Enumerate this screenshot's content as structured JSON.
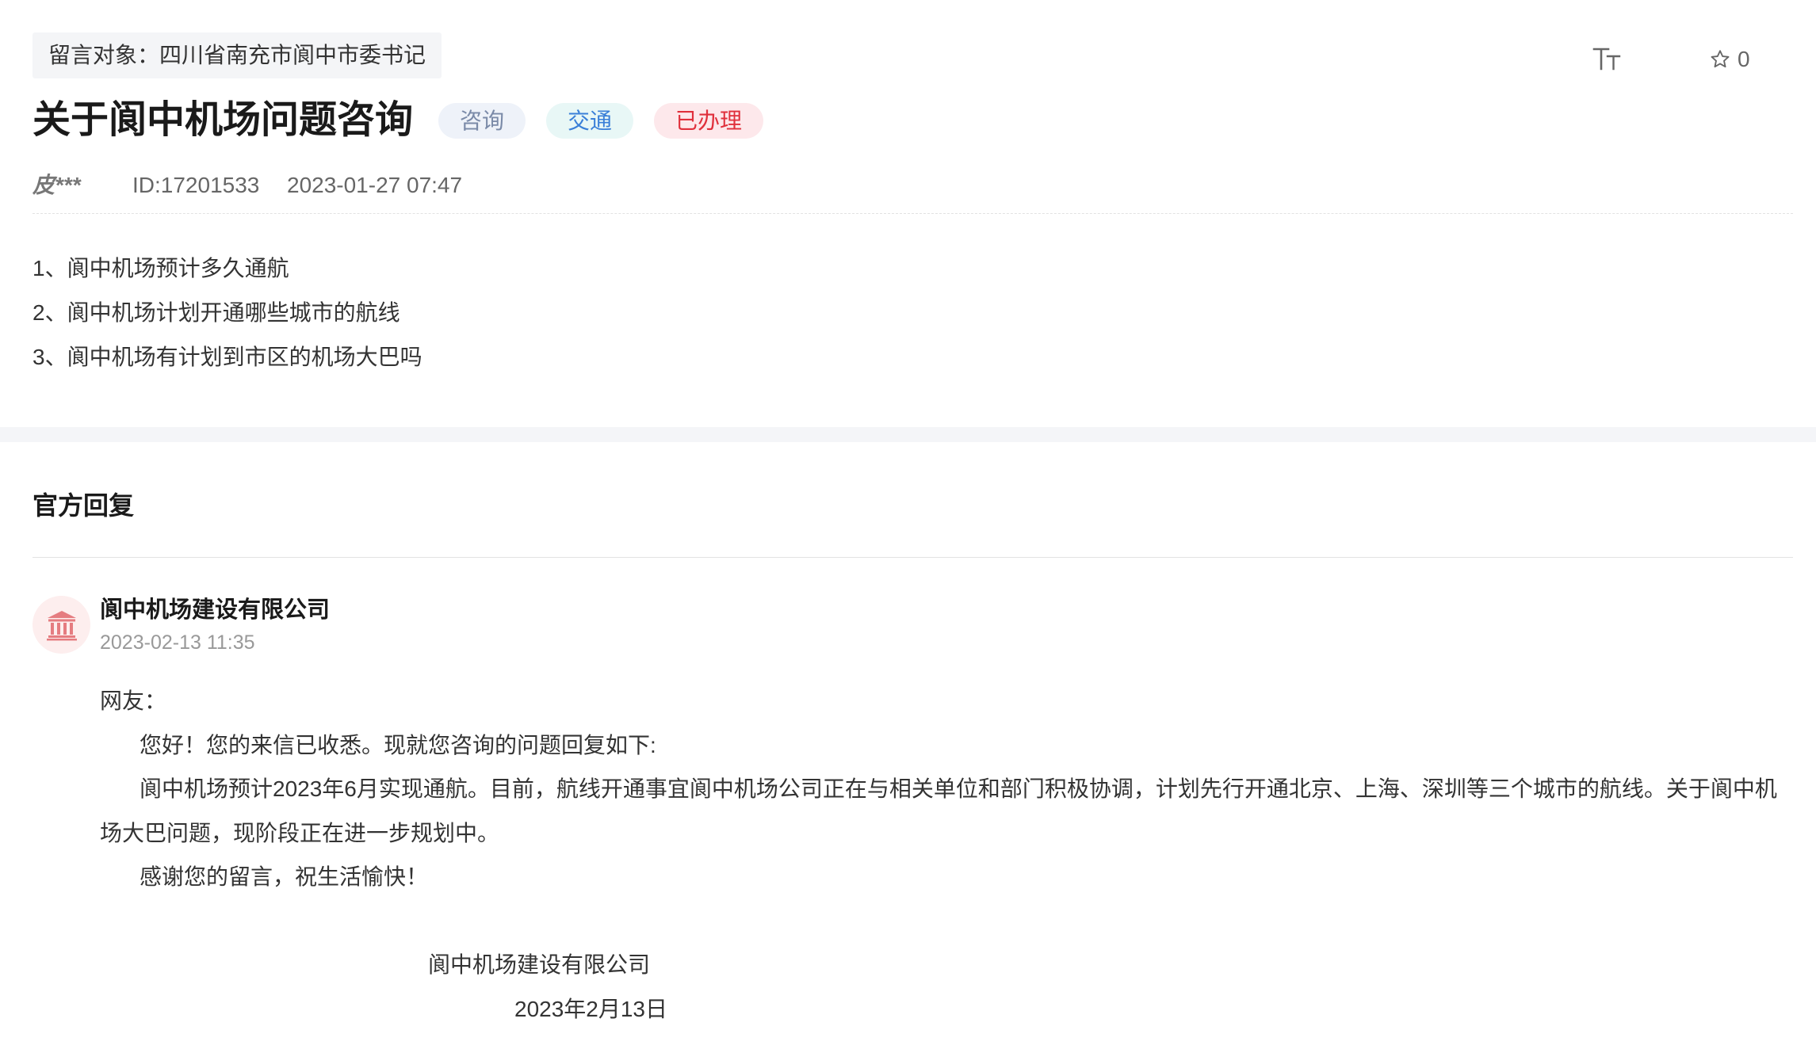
{
  "message": {
    "target": "留言对象：四川省南充市阆中市委书记",
    "title": "关于阆中机场问题咨询",
    "tags": [
      {
        "label": "咨询",
        "bg": "#eef2f9",
        "color": "#7a8aa8"
      },
      {
        "label": "交通",
        "bg": "#e8f7f6",
        "color": "#3a7fd8"
      },
      {
        "label": "已办理",
        "bg": "#fde8eb",
        "color": "#e0303c"
      }
    ],
    "author": "皮***",
    "id": "ID:17201533",
    "time": "2023-01-27 07:47",
    "lines": [
      "1、阆中机场预计多久通航",
      "2、阆中机场计划开通哪些城市的航线",
      "3、阆中机场有计划到市区的机场大巴吗"
    ]
  },
  "toolbar": {
    "font_size_icon": "font-size-icon",
    "favorite_icon": "star-outline-icon",
    "favorite_count": "0"
  },
  "reply": {
    "section_title": "官方回复",
    "avatar_icon": "bank-icon",
    "org": "阆中机场建设有限公司",
    "time": "2023-02-13 11:35",
    "greeting": "网友：",
    "paragraphs": [
      "您好！您的来信已收悉。现就您咨询的问题回复如下:",
      "阆中机场预计2023年6月实现通航。目前，航线开通事宜阆中机场公司正在与相关单位和部门积极协调，计划先行开通北京、上海、深圳等三个城市的航线。关于阆中机场大巴问题，现阶段正在进一步规划中。",
      "感谢您的留言，祝生活愉快！"
    ],
    "signature_org": "阆中机场建设有限公司",
    "signature_date": "2023年2月13日"
  },
  "colors": {
    "avatar_bg": "#fdeeee",
    "avatar_icon": "#e57c80",
    "divider": "#e3e3e3",
    "band": "#f4f5f8"
  }
}
